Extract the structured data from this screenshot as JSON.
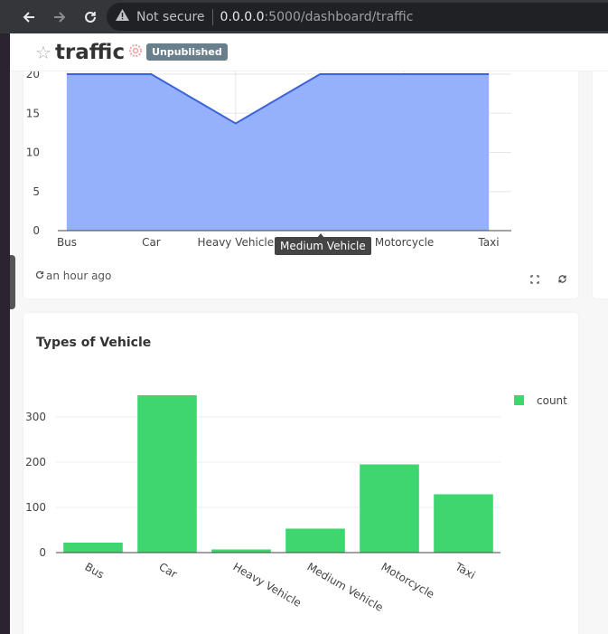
{
  "browser": {
    "security_label": "Not secure",
    "url_host": "0.0.0.0",
    "url_rest": ":5000/dashboard/traffic"
  },
  "dashboard": {
    "title": "traffic",
    "status_badge": "Unpublished"
  },
  "area_card": {
    "last_refreshed": "an hour ago",
    "tooltip": "Medium Vehicle"
  },
  "bar_card": {
    "title": "Types of Vehicle"
  },
  "chart_data": [
    {
      "type": "area",
      "categories": [
        "Bus",
        "Car",
        "Heavy Vehicle",
        "Medium Vehicle",
        "Motorcycle",
        "Taxi"
      ],
      "values": [
        20,
        20,
        13.7,
        20,
        20,
        20
      ],
      "ylim": [
        0,
        20
      ],
      "yticks": [
        0,
        5,
        10,
        15,
        20
      ],
      "grid": true,
      "colors": {
        "fill": "#96b1fb",
        "line": "#3d63db"
      }
    },
    {
      "type": "bar",
      "title": "Types of Vehicle",
      "categories": [
        "Bus",
        "Car",
        "Heavy Vehicle",
        "Medium Vehicle",
        "Motorcycle",
        "Taxi"
      ],
      "series": [
        {
          "name": "count",
          "values": [
            22,
            348,
            7,
            53,
            195,
            129
          ]
        }
      ],
      "ylim": [
        0,
        375
      ],
      "yticks": [
        0,
        100,
        200,
        300
      ],
      "legend": "top-right",
      "grid": true,
      "colors": {
        "bar": "#3dd66f"
      }
    }
  ]
}
